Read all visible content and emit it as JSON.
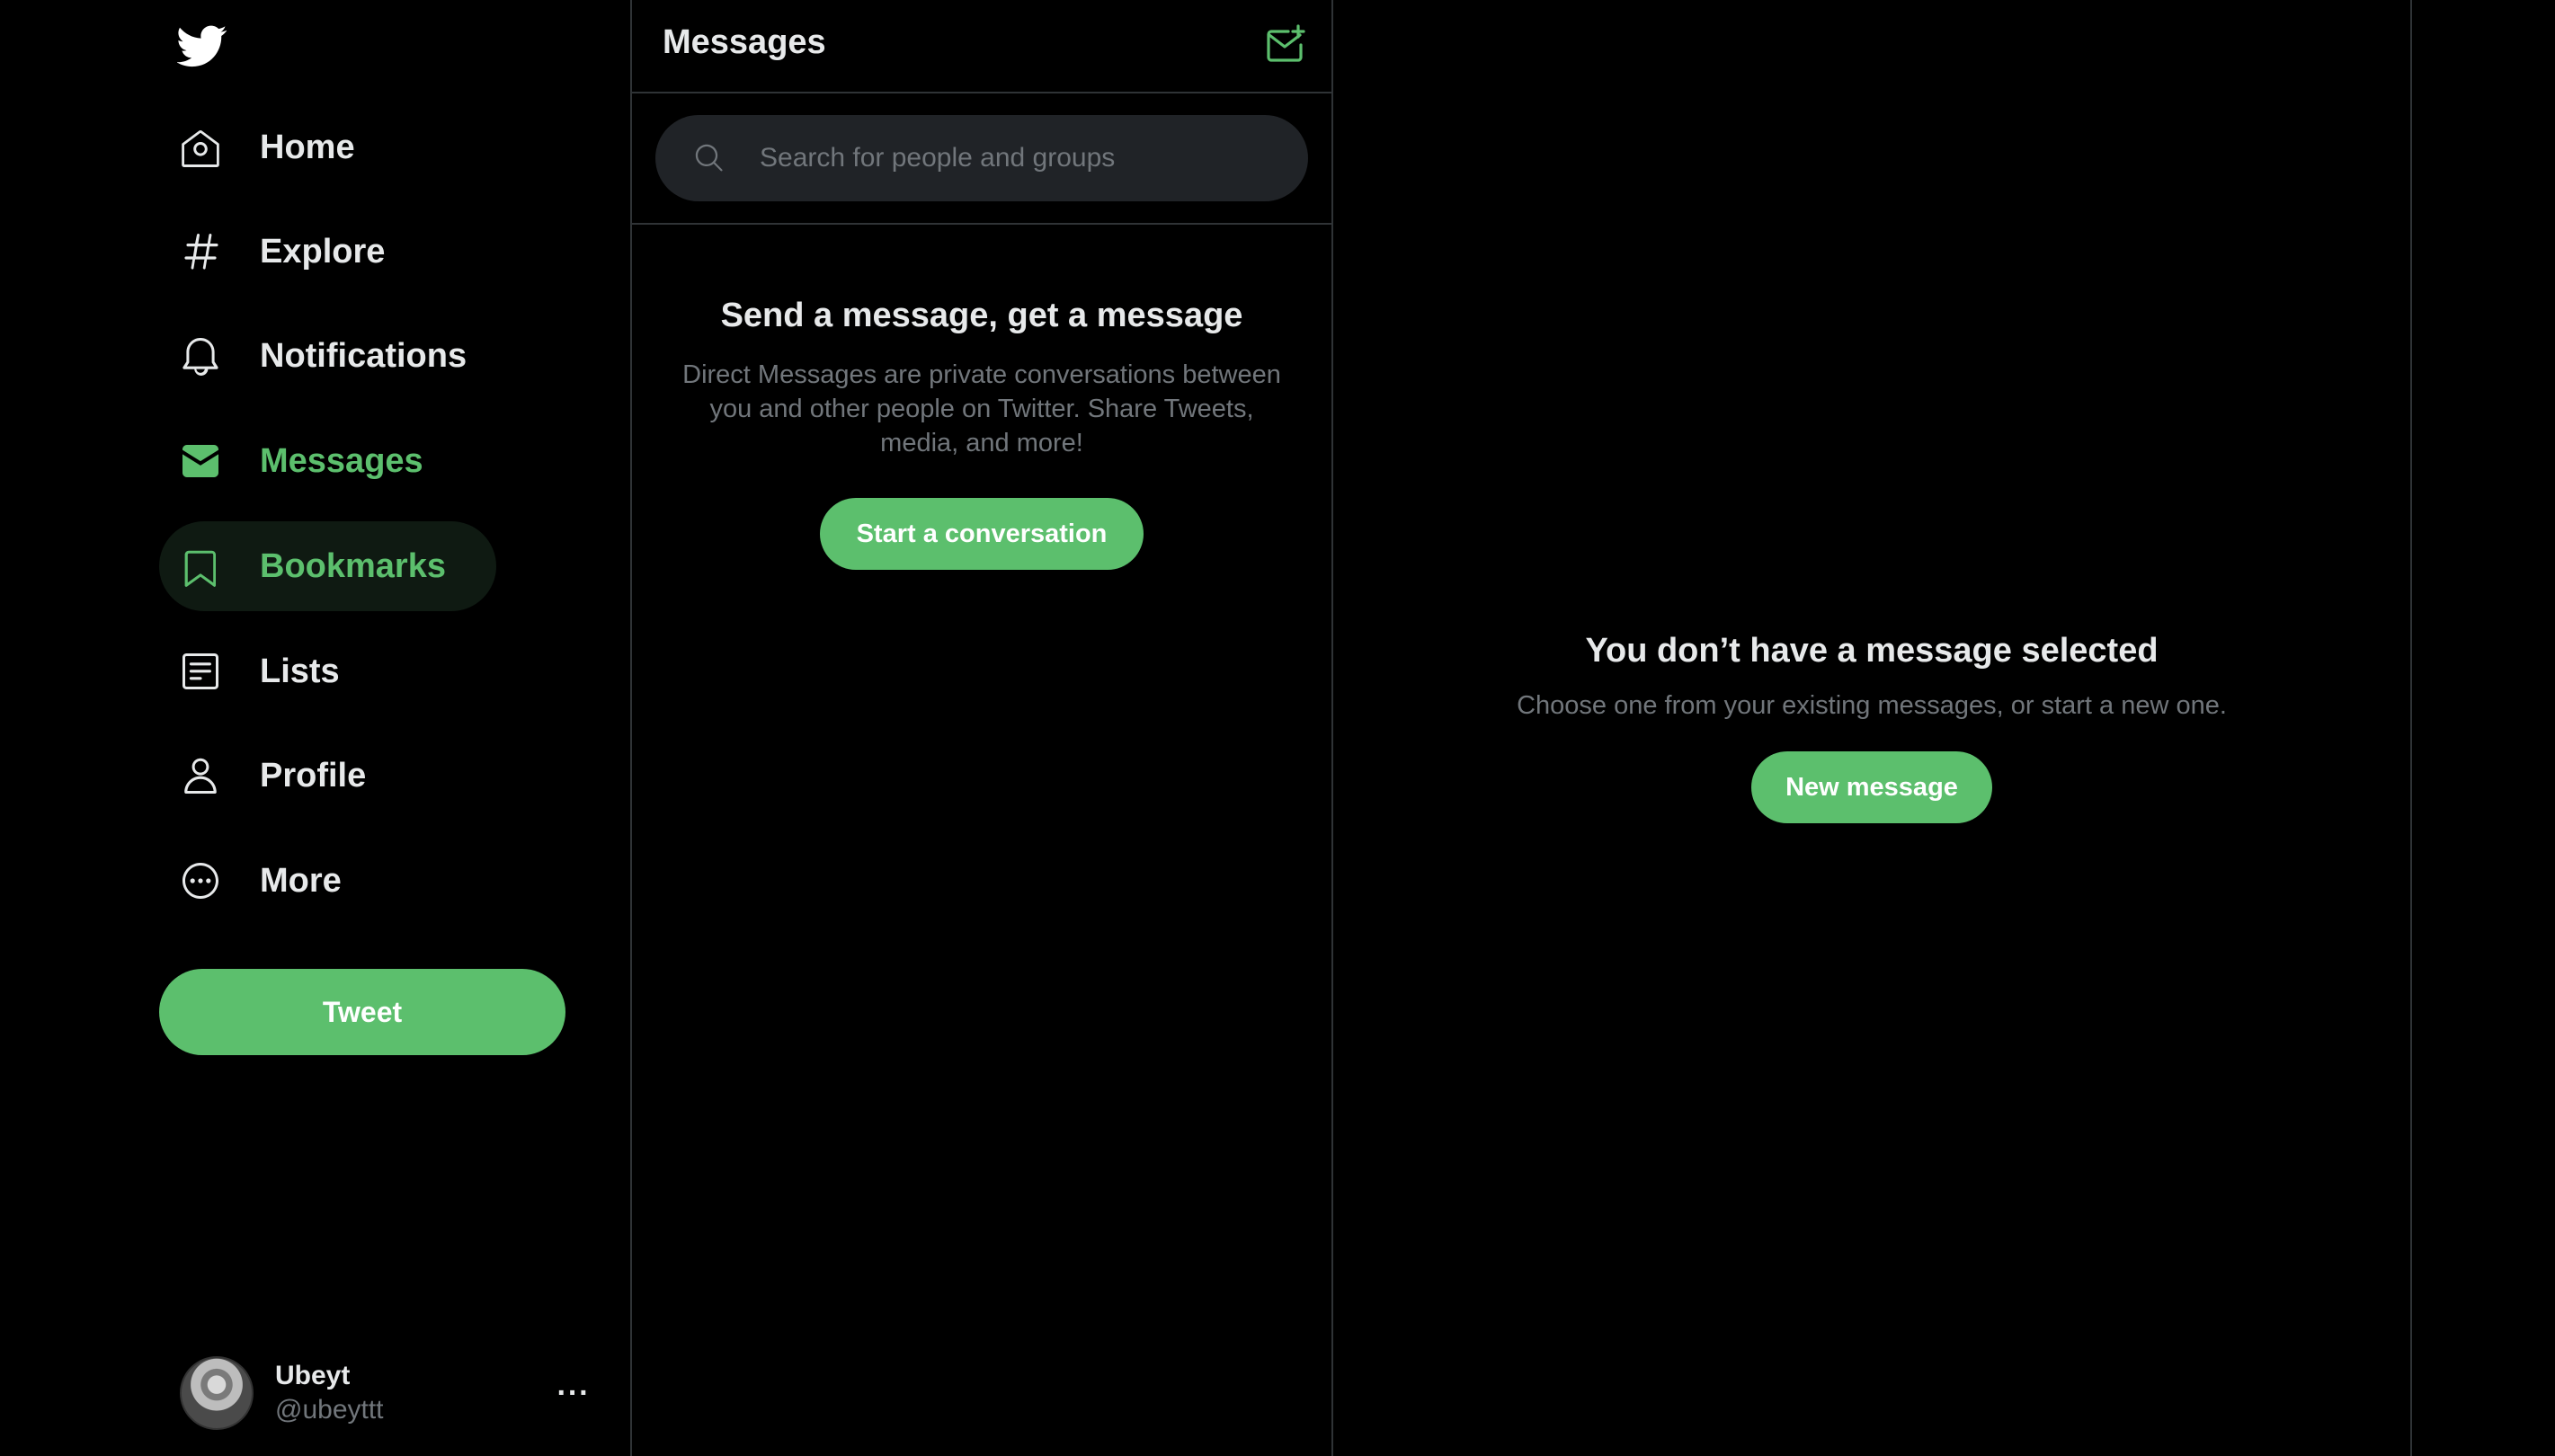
{
  "colors": {
    "accent": "#5cbf6d",
    "background": "#000000",
    "text_primary": "#e7e9ea",
    "text_secondary": "#71767b",
    "border": "#2f3336",
    "search_bg": "#202327"
  },
  "logo": {
    "icon": "twitter-bird-icon"
  },
  "sidebar": {
    "items": [
      {
        "label": "Home",
        "icon": "home-icon",
        "active": false
      },
      {
        "label": "Explore",
        "icon": "hashtag-icon",
        "active": false
      },
      {
        "label": "Notifications",
        "icon": "bell-icon",
        "active": false
      },
      {
        "label": "Messages",
        "icon": "envelope-icon",
        "active": true
      },
      {
        "label": "Bookmarks",
        "icon": "bookmark-icon",
        "active": true
      },
      {
        "label": "Lists",
        "icon": "list-icon",
        "active": false
      },
      {
        "label": "Profile",
        "icon": "person-icon",
        "active": false
      },
      {
        "label": "More",
        "icon": "more-circle-icon",
        "active": false
      }
    ],
    "tweet_label": "Tweet"
  },
  "account": {
    "name": "Ubeyt",
    "handle": "@ubeyttt",
    "more_icon": "ellipsis-icon"
  },
  "messages": {
    "title": "Messages",
    "compose_icon": "new-message-envelope-icon",
    "search": {
      "placeholder": "Search for people and groups",
      "value": ""
    },
    "empty": {
      "title": "Send a message, get a message",
      "description": "Direct Messages are private conversations between you and other people on Twitter. Share Tweets, media, and more!",
      "button": "Start a conversation"
    }
  },
  "detail": {
    "title": "You don’t have a message selected",
    "description": "Choose one from your existing messages, or start a new one.",
    "button": "New message"
  }
}
